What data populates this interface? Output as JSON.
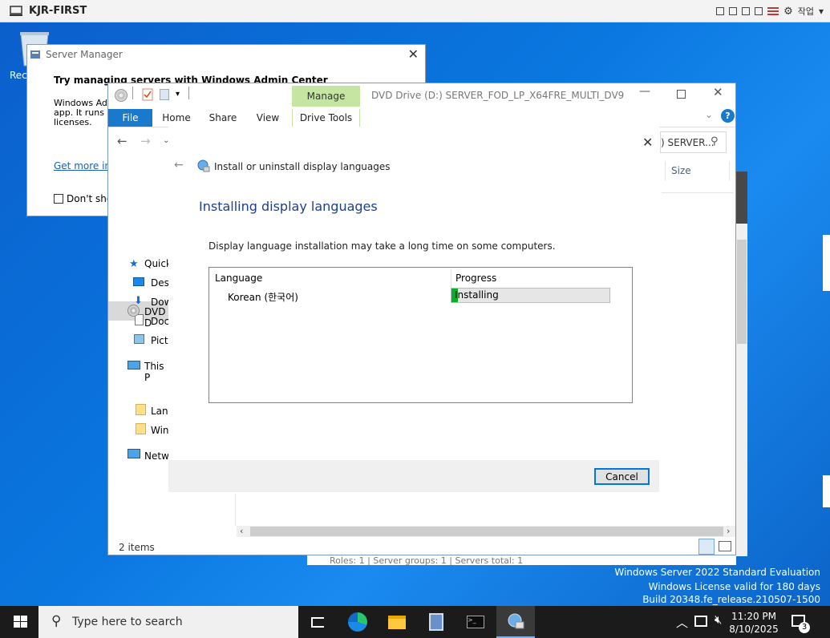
{
  "host": {
    "title": "KJR-FIRST",
    "work_label": "작업"
  },
  "desktop": {
    "recycle_label": "Rec",
    "watermark": {
      "line1": "Windows Server 2022 Standard Evaluation",
      "line2": "Windows License valid for 180 days",
      "line3": "Build 20348.fe_release.210507-1500"
    }
  },
  "server_manager": {
    "title": "Server Manager",
    "heading": "Try managing servers with Windows Admin Center",
    "body_lines": [
      "Windows Adm",
      "app. It runs or",
      "licenses."
    ],
    "link": "Get more info",
    "checkbox_label": "Don't show"
  },
  "explorer": {
    "title": "DVD Drive (D:) SERVER_FOD_LP_X64FRE_MULTI_DV9",
    "manage_label": "Manage",
    "tabs": [
      "File",
      "Home",
      "Share",
      "View",
      "Drive Tools"
    ],
    "search_text": ") SERVER...",
    "column_size": "Size",
    "status": "2 items",
    "behind_text": "Roles: 1  |  Server groups: 1  |  Servers total: 1",
    "nav": [
      {
        "label": "Quick",
        "icon": "star-icon"
      },
      {
        "label": "Desk",
        "icon": "desktop-icon"
      },
      {
        "label": "Dow",
        "icon": "download-icon"
      },
      {
        "label": "Doc",
        "icon": "document-icon"
      },
      {
        "label": "Pictu",
        "icon": "picture-icon"
      },
      {
        "label": "This P",
        "icon": "computer-icon"
      },
      {
        "label": "DVD D",
        "icon": "disc-icon"
      },
      {
        "label": "Lang",
        "icon": "folder-icon"
      },
      {
        "label": "Win",
        "icon": "folder-icon"
      },
      {
        "label": "Netw",
        "icon": "network-icon"
      }
    ]
  },
  "dialog": {
    "nav_title": "Install or uninstall display languages",
    "heading": "Installing display languages",
    "description": "Display language installation may take a long time on some computers.",
    "col_language": "Language",
    "col_progress": "Progress",
    "row_language": "Korean (한국어)",
    "row_status": "Installing",
    "progress_fraction": 0.04,
    "cancel": "Cancel"
  },
  "taskbar": {
    "search_placeholder": "Type here to search",
    "time": "11:20 PM",
    "date": "8/10/2025",
    "notification_count": "3"
  },
  "colors": {
    "accent": "#1979ca",
    "progress": "#06b025",
    "heading": "#1e3f8c"
  }
}
